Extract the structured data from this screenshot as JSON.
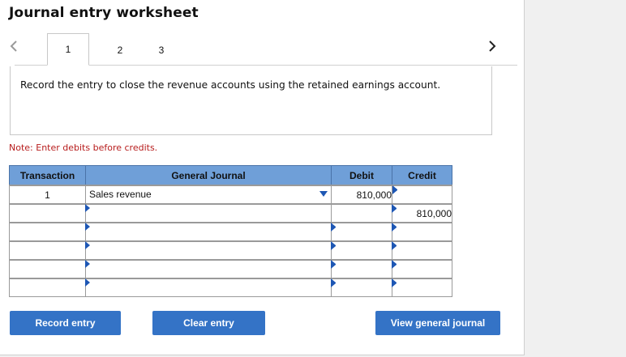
{
  "header": {
    "title": "Journal entry worksheet"
  },
  "tabs": [
    {
      "label": "1",
      "active": true
    },
    {
      "label": "2",
      "active": false
    },
    {
      "label": "3",
      "active": false
    }
  ],
  "icons": {
    "prev": "chevron-left-icon",
    "next": "chevron-right-icon",
    "dropdown": "caret-down-icon"
  },
  "instruction": {
    "text": "Record the entry to close the revenue accounts using the retained earnings account."
  },
  "note": {
    "text": "Note: Enter debits before credits."
  },
  "journal": {
    "headers": {
      "transaction": "Transaction",
      "general_journal": "General Journal",
      "debit": "Debit",
      "credit": "Credit"
    },
    "rows": [
      {
        "transaction": "1",
        "account": "Sales revenue",
        "debit": "810,000",
        "credit": ""
      },
      {
        "transaction": "",
        "account": "",
        "debit": "",
        "credit": "810,000"
      },
      {
        "transaction": "",
        "account": "",
        "debit": "",
        "credit": ""
      },
      {
        "transaction": "",
        "account": "",
        "debit": "",
        "credit": ""
      },
      {
        "transaction": "",
        "account": "",
        "debit": "",
        "credit": ""
      },
      {
        "transaction": "",
        "account": "",
        "debit": "",
        "credit": ""
      }
    ]
  },
  "buttons": {
    "record": "Record entry",
    "clear": "Clear entry",
    "view": "View general journal"
  },
  "colors": {
    "accent": "#3473c6",
    "header_bg": "#6f9fd8",
    "note": "#b71c1c"
  }
}
